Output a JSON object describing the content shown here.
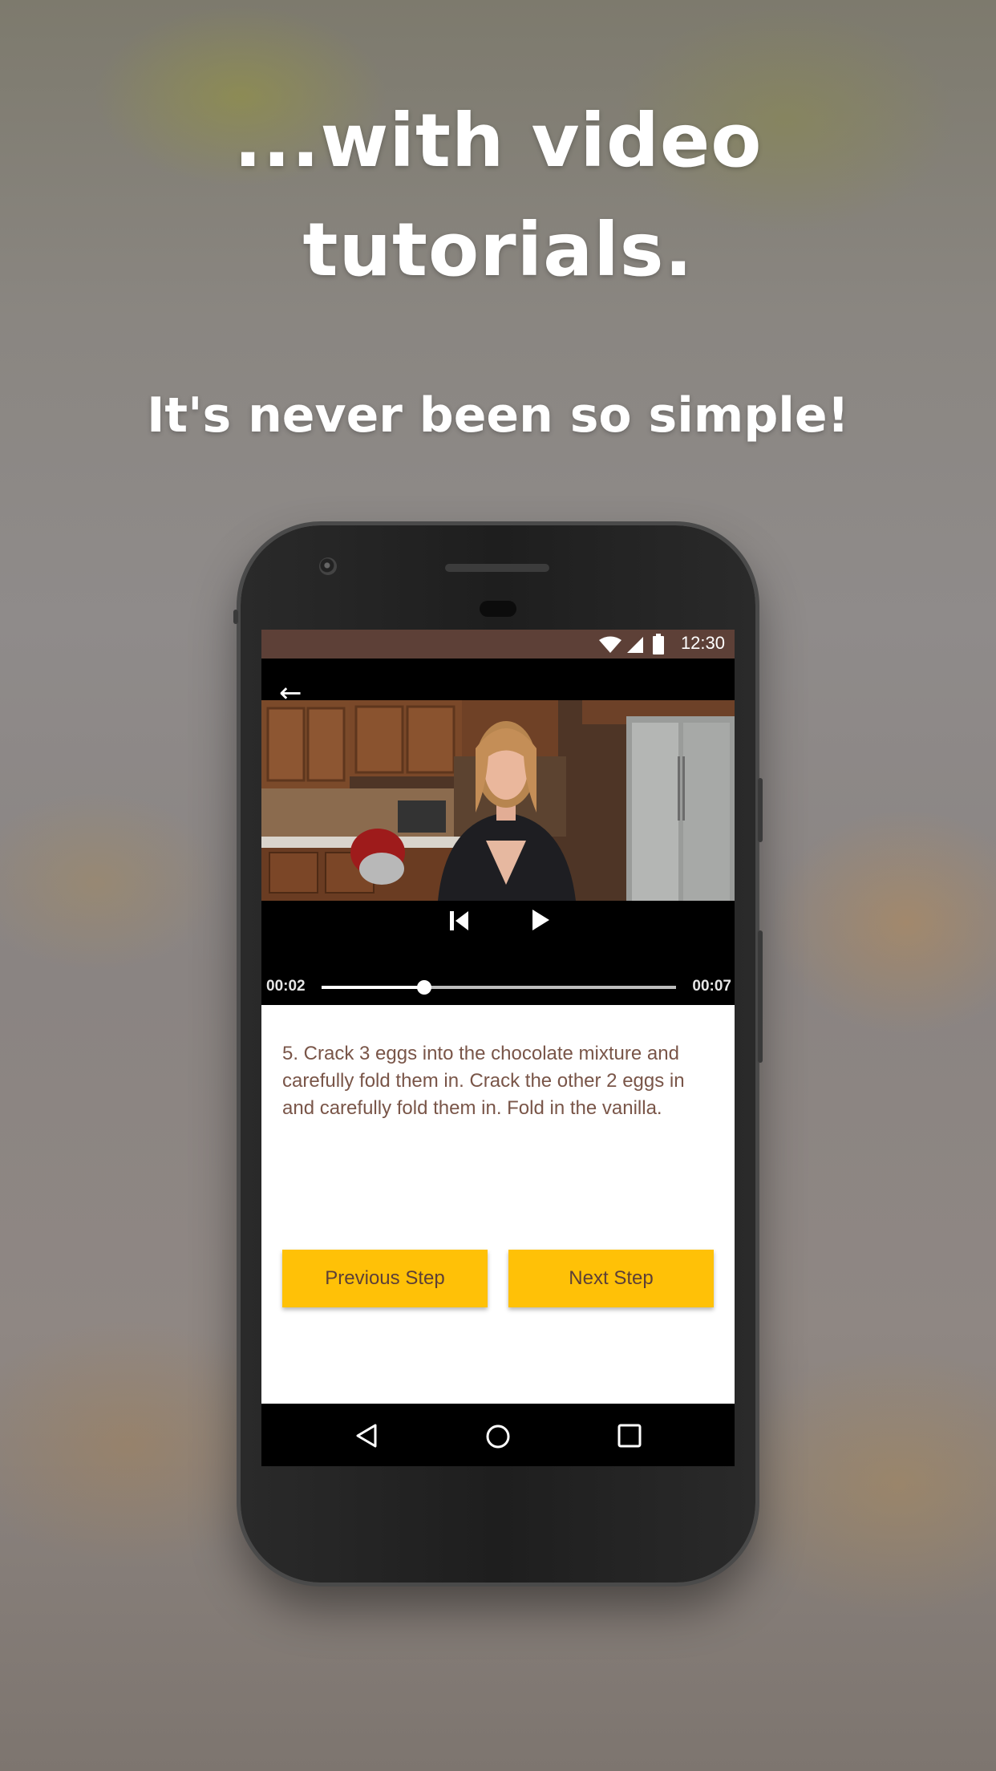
{
  "headline": "...with video\ntutorials.",
  "headline_line1": "...with video",
  "headline_line2": "tutorials.",
  "subheadline": "It's never been so simple!",
  "status_bar": {
    "time": "12:30",
    "color": "#5d4037",
    "icons": [
      "wifi-icon",
      "cell-signal-icon",
      "battery-icon"
    ]
  },
  "video_player": {
    "back_icon": "arrow-left-icon",
    "controls": [
      "skip-previous-icon",
      "play-icon"
    ],
    "elapsed": "00:02",
    "duration": "00:07",
    "progress": 0.29
  },
  "step": {
    "text": "5. Crack 3 eggs into the chocolate mixture and carefully fold them in. Crack the other 2 eggs in and carefully fold them in. Fold in the vanilla."
  },
  "buttons": {
    "previous_label": "Previous Step",
    "next_label": "Next Step",
    "color": "#ffc107",
    "text_color": "#5d4037"
  },
  "nav_bar": {
    "icons": [
      "back-triangle-icon",
      "home-circle-icon",
      "recents-square-icon"
    ]
  }
}
